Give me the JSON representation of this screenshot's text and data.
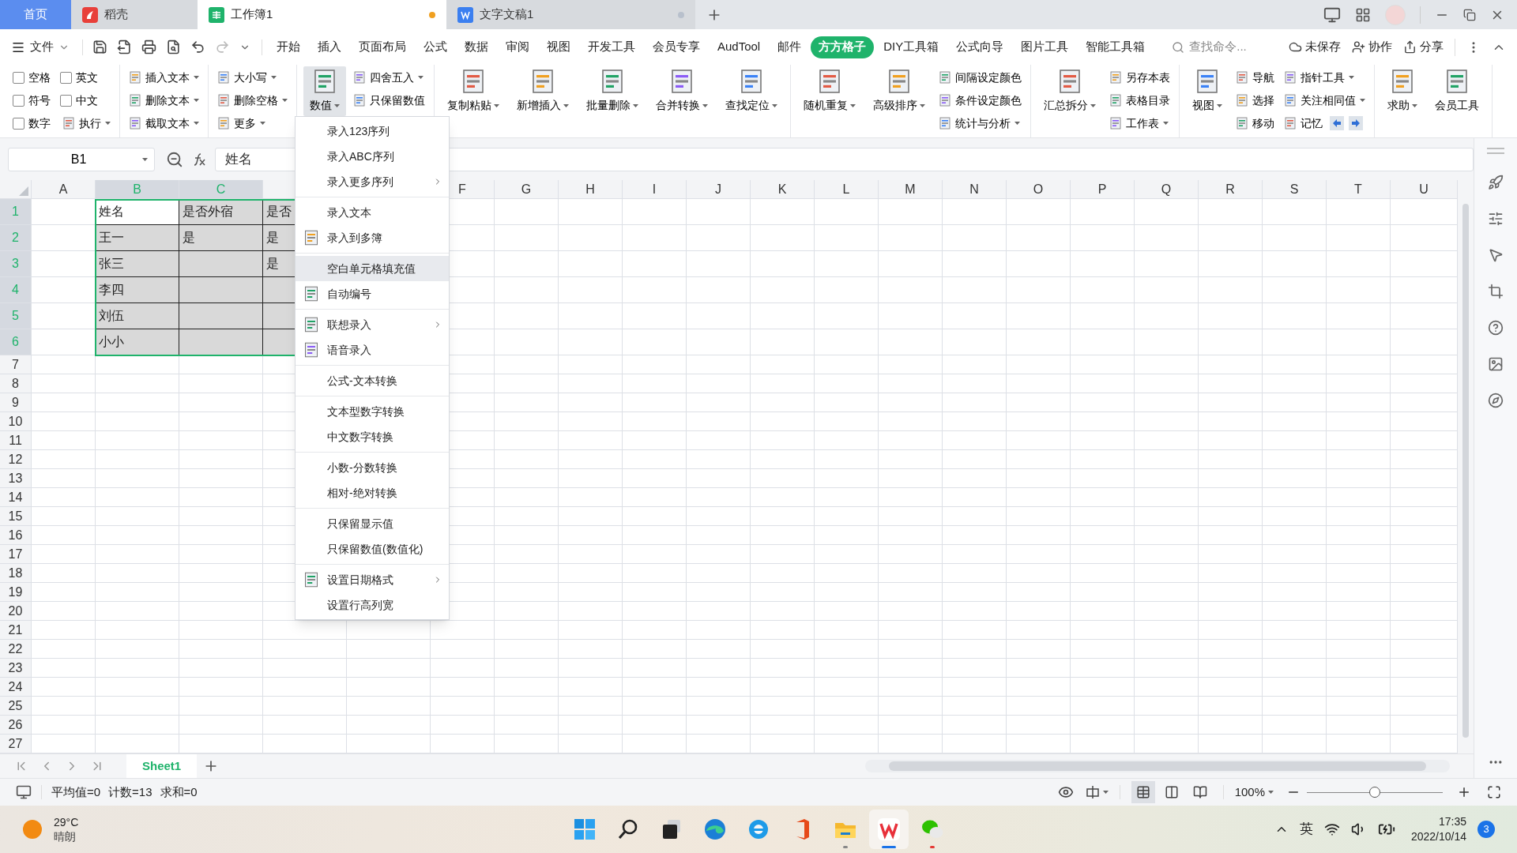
{
  "title_tabs": [
    {
      "label": "首页",
      "kind": "home",
      "selected": false
    },
    {
      "label": "稻壳",
      "kind": "docer",
      "selected": false
    },
    {
      "label": "工作簿1",
      "kind": "sheet",
      "selected": true,
      "color": "#f0a020"
    },
    {
      "label": "文字文稿1",
      "kind": "writer",
      "selected": false,
      "color": "#b8c0cc"
    }
  ],
  "menu": {
    "file": "文件",
    "tabs": [
      {
        "label": "开始",
        "selected": false
      },
      {
        "label": "插入",
        "selected": false
      },
      {
        "label": "页面布局",
        "selected": false
      },
      {
        "label": "公式",
        "selected": false
      },
      {
        "label": "数据",
        "selected": false
      },
      {
        "label": "审阅",
        "selected": false
      },
      {
        "label": "视图",
        "selected": false
      },
      {
        "label": "开发工具",
        "selected": false
      },
      {
        "label": "会员专享",
        "selected": false
      },
      {
        "label": "AudTool",
        "selected": false
      },
      {
        "label": "邮件",
        "selected": false
      },
      {
        "label": "方方格子",
        "selected": true
      },
      {
        "label": "DIY工具箱",
        "selected": false
      },
      {
        "label": "公式向导",
        "selected": false
      },
      {
        "label": "图片工具",
        "selected": false
      },
      {
        "label": "智能工具箱",
        "selected": false
      }
    ],
    "search": {
      "placeholder": "查找命令..."
    },
    "actions": [
      "未保存",
      "协作",
      "分享"
    ]
  },
  "ribbon": [
    {
      "columns": [
        {
          "kind": "stack",
          "items": [
            {
              "kind": "checkbox",
              "label": "空格",
              "checked": false
            },
            {
              "kind": "checkbox",
              "label": "符号",
              "checked": false
            },
            {
              "kind": "checkbox",
              "label": "数字",
              "checked": false
            }
          ]
        },
        {
          "kind": "stack",
          "items": [
            {
              "kind": "checkbox",
              "label": "英文",
              "checked": false
            },
            {
              "kind": "checkbox",
              "label": "中文",
              "checked": false
            },
            {
              "kind": "button",
              "label": "执行",
              "dropdown": true
            }
          ]
        }
      ]
    },
    {
      "columns": [
        {
          "kind": "stack",
          "items": [
            {
              "kind": "button",
              "label": "插入文本",
              "dropdown": true
            },
            {
              "kind": "button",
              "label": "删除文本",
              "dropdown": true
            },
            {
              "kind": "button",
              "label": "截取文本",
              "dropdown": true
            }
          ]
        }
      ]
    },
    {
      "columns": [
        {
          "kind": "stack",
          "items": [
            {
              "kind": "button",
              "label": "大小写",
              "dropdown": true
            },
            {
              "kind": "button",
              "label": "删除空格",
              "dropdown": true
            },
            {
              "kind": "button",
              "label": "更多",
              "dropdown": true
            }
          ]
        }
      ]
    },
    {
      "columns": [
        {
          "kind": "large",
          "label": "数值",
          "dropdown": true,
          "pressed": true
        },
        {
          "kind": "stack",
          "items": [
            {
              "kind": "button",
              "label": "四舍五入",
              "dropdown": true
            },
            {
              "kind": "button",
              "label": "只保留数值",
              "dropdown": false
            }
          ]
        }
      ]
    },
    {
      "columns": [
        {
          "kind": "large",
          "label": "复制粘贴",
          "dropdown": true,
          "pressed": false
        },
        {
          "kind": "large",
          "label": "新增插入",
          "dropdown": true,
          "pressed": false
        },
        {
          "kind": "large",
          "label": "批量删除",
          "dropdown": true,
          "pressed": false
        },
        {
          "kind": "large",
          "label": "合并转换",
          "dropdown": true,
          "pressed": false
        },
        {
          "kind": "large",
          "label": "查找定位",
          "dropdown": true,
          "pressed": false
        }
      ]
    },
    {
      "columns": [
        {
          "kind": "large",
          "label": "随机重复",
          "dropdown": true,
          "pressed": false
        },
        {
          "kind": "large",
          "label": "高级排序",
          "dropdown": true,
          "pressed": false
        },
        {
          "kind": "stack",
          "items": [
            {
              "kind": "button",
              "label": "间隔设定颜色",
              "dropdown": false
            },
            {
              "kind": "button",
              "label": "条件设定颜色",
              "dropdown": false
            },
            {
              "kind": "button",
              "label": "统计与分析",
              "dropdown": true
            }
          ]
        }
      ]
    },
    {
      "columns": [
        {
          "kind": "large",
          "label": "汇总拆分",
          "dropdown": true,
          "pressed": false
        },
        {
          "kind": "stack",
          "items": [
            {
              "kind": "button",
              "label": "另存本表",
              "dropdown": false
            },
            {
              "kind": "button",
              "label": "表格目录",
              "dropdown": false
            },
            {
              "kind": "button",
              "label": "工作表",
              "dropdown": true
            }
          ]
        }
      ]
    },
    {
      "columns": [
        {
          "kind": "large",
          "label": "视图",
          "dropdown": true,
          "pressed": false
        },
        {
          "kind": "stack",
          "items": [
            {
              "kind": "button",
              "label": "导航",
              "dropdown": false
            },
            {
              "kind": "button",
              "label": "选择",
              "dropdown": false
            },
            {
              "kind": "button",
              "label": "移动",
              "dropdown": false
            }
          ]
        },
        {
          "kind": "stack",
          "items": [
            {
              "kind": "button",
              "label": "指针工具",
              "dropdown": true
            },
            {
              "kind": "button",
              "label": "关注相同值",
              "dropdown": true
            },
            {
              "kind": "memory",
              "label": "记忆",
              "dropdown": false
            }
          ]
        }
      ]
    },
    {
      "columns": [
        {
          "kind": "large",
          "label": "求助",
          "dropdown": true,
          "pressed": false
        },
        {
          "kind": "large",
          "label": "会员工具",
          "dropdown": false,
          "pressed": false
        }
      ]
    }
  ],
  "name_box": "B1",
  "formula": "姓名",
  "sheet": {
    "columns": [
      {
        "label": "A",
        "selected": false
      },
      {
        "label": "B",
        "selected": true
      },
      {
        "label": "C",
        "selected": true
      },
      {},
      {},
      {
        "label": "F",
        "selected": false
      },
      {
        "label": "G",
        "selected": false
      },
      {
        "label": "H",
        "selected": false
      },
      {
        "label": "I",
        "selected": false
      },
      {
        "label": "J",
        "selected": false
      },
      {
        "label": "K",
        "selected": false
      },
      {
        "label": "L",
        "selected": false
      },
      {
        "label": "M",
        "selected": false
      },
      {
        "label": "N",
        "selected": false
      },
      {
        "label": "O",
        "selected": false
      },
      {
        "label": "P",
        "selected": false
      },
      {
        "label": "Q",
        "selected": false
      },
      {
        "label": "R",
        "selected": false
      },
      {
        "label": "S",
        "selected": false
      },
      {
        "label": "T",
        "selected": false
      },
      {
        "label": "U",
        "selected": false
      }
    ],
    "rows": [
      {
        "label": "1",
        "selected": true,
        "cells": [
          {
            "text": "姓名",
            "active": true
          },
          {
            "text": "是否外宿",
            "active": false
          },
          {
            "text": "是否",
            "active": false
          }
        ]
      },
      {
        "label": "2",
        "selected": true,
        "cells": [
          {
            "text": "王一",
            "active": false
          },
          {
            "text": "是",
            "active": false
          },
          {
            "text": "是",
            "active": false
          }
        ]
      },
      {
        "label": "3",
        "selected": true,
        "cells": [
          {
            "text": "张三",
            "active": false
          },
          {
            "active": false
          },
          {
            "text": "是",
            "active": false
          }
        ]
      },
      {
        "label": "4",
        "selected": true,
        "cells": [
          {
            "text": "李四",
            "active": false
          },
          {
            "active": false
          },
          {
            "active": false
          }
        ]
      },
      {
        "label": "5",
        "selected": true,
        "cells": [
          {
            "text": "刘伍",
            "active": false
          },
          {
            "active": false
          },
          {
            "active": false
          }
        ]
      },
      {
        "label": "6",
        "selected": true,
        "cells": [
          {
            "text": "小小",
            "active": false
          },
          {
            "active": false
          },
          {
            "active": false
          }
        ]
      },
      {
        "label": "7",
        "selected": false
      },
      {
        "label": "8",
        "selected": false
      },
      {
        "label": "9",
        "selected": false
      },
      {
        "label": "10",
        "selected": false
      },
      {
        "label": "11",
        "selected": false
      },
      {
        "label": "12",
        "selected": false
      },
      {
        "label": "13",
        "selected": false
      },
      {
        "label": "14",
        "selected": false
      },
      {
        "label": "15",
        "selected": false
      },
      {
        "label": "16",
        "selected": false
      },
      {
        "label": "17",
        "selected": false
      },
      {
        "label": "18",
        "selected": false
      },
      {
        "label": "19",
        "selected": false
      },
      {
        "label": "20",
        "selected": false
      },
      {
        "label": "21",
        "selected": false
      },
      {
        "label": "22",
        "selected": false
      },
      {
        "label": "23",
        "selected": false
      },
      {
        "label": "24",
        "selected": false
      },
      {
        "label": "25",
        "selected": false
      },
      {
        "label": "26",
        "selected": false
      },
      {
        "label": "27",
        "selected": false
      }
    ]
  },
  "dropdown": {
    "groups": [
      [
        {
          "label": "录入123序列",
          "has_icon": false,
          "submenu": false,
          "highlighted": false
        },
        {
          "label": "录入ABC序列",
          "has_icon": false,
          "submenu": false,
          "highlighted": false
        },
        {
          "label": "录入更多序列",
          "has_icon": false,
          "submenu": true,
          "highlighted": false
        }
      ],
      [
        {
          "label": "录入文本",
          "has_icon": false,
          "submenu": false,
          "highlighted": false
        },
        {
          "label": "录入到多簿",
          "has_icon": true,
          "submenu": false,
          "highlighted": false
        }
      ],
      [
        {
          "label": "空白单元格填充值",
          "has_icon": false,
          "submenu": false,
          "highlighted": true
        },
        {
          "label": "自动编号",
          "has_icon": true,
          "submenu": false,
          "highlighted": false
        }
      ],
      [
        {
          "label": "联想录入",
          "has_icon": true,
          "submenu": true,
          "highlighted": false
        },
        {
          "label": "语音录入",
          "has_icon": true,
          "submenu": false,
          "highlighted": false
        }
      ],
      [
        {
          "label": "公式-文本转换",
          "has_icon": false,
          "submenu": false,
          "highlighted": false
        }
      ],
      [
        {
          "label": "文本型数字转换",
          "has_icon": false,
          "submenu": false,
          "highlighted": false
        },
        {
          "label": "中文数字转换",
          "has_icon": false,
          "submenu": false,
          "highlighted": false
        }
      ],
      [
        {
          "label": "小数-分数转换",
          "has_icon": false,
          "submenu": false,
          "highlighted": false
        },
        {
          "label": "相对-绝对转换",
          "has_icon": false,
          "submenu": false,
          "highlighted": false
        }
      ],
      [
        {
          "label": "只保留显示值",
          "has_icon": false,
          "submenu": false,
          "highlighted": false
        },
        {
          "label": "只保留数值(数值化)",
          "has_icon": false,
          "submenu": false,
          "highlighted": false
        }
      ],
      [
        {
          "label": "设置日期格式",
          "has_icon": true,
          "submenu": true,
          "highlighted": false
        },
        {
          "label": "设置行高列宽",
          "has_icon": false,
          "submenu": false,
          "highlighted": false
        }
      ]
    ]
  },
  "sheet_tabs": [
    {
      "label": "Sheet1",
      "selected": true
    }
  ],
  "status": {
    "stats": [
      "平均值=0",
      "计数=13",
      "求和=0"
    ],
    "views": [
      {
        "selected": true
      },
      {
        "selected": false
      },
      {
        "selected": false
      }
    ],
    "zoom": "100%",
    "level": 0.5
  },
  "taskbar": {
    "weather": {
      "temp": "29°C",
      "desc": "晴朗"
    },
    "apps": [
      {
        "kind": "start",
        "running": false,
        "selected": false,
        "alert": false
      },
      {
        "kind": "search",
        "running": false,
        "selected": false,
        "alert": false
      },
      {
        "kind": "taskview",
        "running": false,
        "selected": false,
        "alert": false
      },
      {
        "kind": "edge",
        "running": false,
        "selected": false,
        "alert": false
      },
      {
        "kind": "ie",
        "running": false,
        "selected": false,
        "alert": false
      },
      {
        "kind": "office",
        "running": false,
        "selected": false,
        "alert": false
      },
      {
        "kind": "explorer",
        "running": true,
        "selected": false,
        "alert": false
      },
      {
        "kind": "wps",
        "running": true,
        "selected": true,
        "alert": false
      },
      {
        "kind": "wechat",
        "running": true,
        "selected": false,
        "alert": true
      }
    ],
    "ime": "英",
    "time": "17:35",
    "date": "2022/10/14",
    "badge": "3"
  }
}
